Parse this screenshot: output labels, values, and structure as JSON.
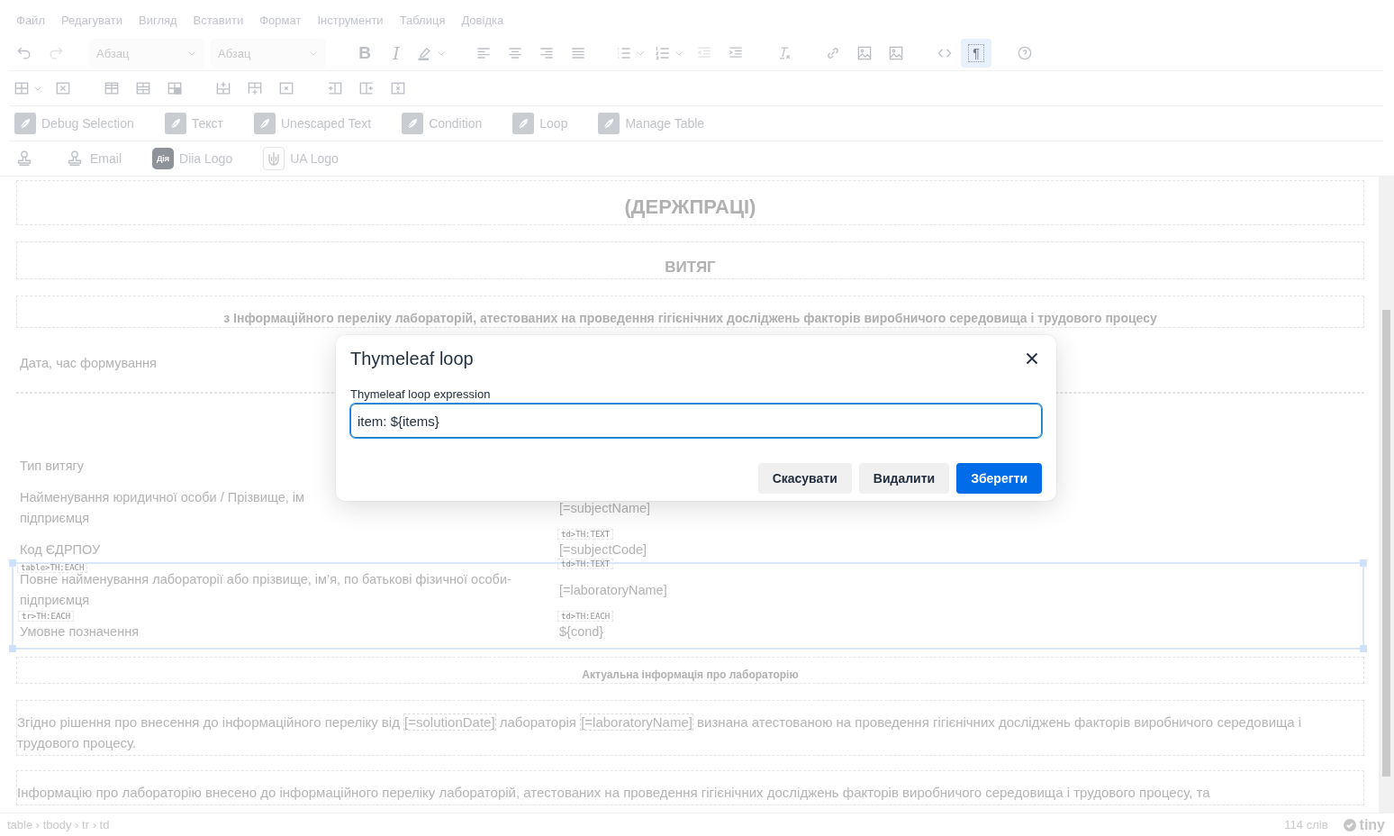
{
  "menubar": [
    "Файл",
    "Редагувати",
    "Вигляд",
    "Вставити",
    "Формат",
    "Інструменти",
    "Таблиця",
    "Довідка"
  ],
  "toolbar": {
    "rows": [
      [
        [
          {
            "kind": "button",
            "disabled": false,
            "active": false
          },
          {
            "kind": "button",
            "disabled": true,
            "active": false
          }
        ],
        [
          {
            "kind": "select",
            "value": "Абзац",
            "disabled": false,
            "active": false
          },
          {
            "kind": "select",
            "value": "Абзац",
            "disabled": false,
            "active": false
          }
        ],
        [
          {
            "kind": "glyph",
            "glyph": "B",
            "disabled": false,
            "active": false
          },
          {
            "kind": "glyph",
            "glyph": "I",
            "disabled": false,
            "active": false
          },
          {
            "kind": "split",
            "disabled": false,
            "active": false
          }
        ],
        [
          {
            "kind": "button",
            "disabled": false,
            "active": false
          },
          {
            "kind": "button",
            "disabled": false,
            "active": false
          },
          {
            "kind": "button",
            "disabled": false,
            "active": false
          },
          {
            "kind": "button",
            "disabled": false,
            "active": false
          }
        ],
        [
          {
            "kind": "split",
            "disabled": false,
            "active": false
          },
          {
            "kind": "split",
            "disabled": false,
            "active": false
          },
          {
            "kind": "button",
            "disabled": true,
            "active": false
          },
          {
            "kind": "button",
            "disabled": false,
            "active": false
          }
        ],
        [
          {
            "kind": "button",
            "disabled": false,
            "active": false
          }
        ],
        [
          {
            "kind": "button",
            "disabled": false,
            "active": false
          },
          {
            "kind": "button",
            "disabled": false,
            "active": false
          },
          {
            "kind": "button",
            "disabled": false,
            "active": false
          }
        ],
        [
          {
            "kind": "button",
            "disabled": false,
            "active": false
          },
          {
            "kind": "glyph-box",
            "glyph": "¶",
            "disabled": false,
            "active": true
          }
        ],
        [
          {
            "kind": "button",
            "disabled": false,
            "active": false
          }
        ]
      ],
      [
        [
          {
            "kind": "split",
            "disabled": false,
            "active": false
          },
          {
            "kind": "button",
            "disabled": false,
            "active": false
          }
        ],
        [
          {
            "kind": "button",
            "disabled": false,
            "active": false
          },
          {
            "kind": "button",
            "disabled": false,
            "active": false
          },
          {
            "kind": "button",
            "disabled": false,
            "active": false
          }
        ],
        [
          {
            "kind": "button",
            "disabled": false,
            "active": false
          },
          {
            "kind": "button",
            "disabled": false,
            "active": false
          },
          {
            "kind": "button",
            "disabled": false,
            "active": false
          }
        ],
        [
          {
            "kind": "button",
            "disabled": false,
            "active": false
          },
          {
            "kind": "button",
            "disabled": false,
            "active": false
          },
          {
            "kind": "button",
            "disabled": false,
            "active": false
          }
        ]
      ]
    ]
  },
  "custom_rows": [
    [
      {
        "kind": "feather",
        "label": "Debug Selection"
      },
      {
        "kind": "feather",
        "label": "Текст"
      },
      {
        "kind": "feather",
        "label": "Unescaped Text"
      },
      {
        "kind": "feather",
        "label": "Condition"
      },
      {
        "kind": "feather",
        "label": "Loop"
      },
      {
        "kind": "feather",
        "label": "Manage Table"
      }
    ],
    [
      {
        "kind": "stamp"
      },
      {
        "kind": "stamp",
        "label": "Email"
      },
      {
        "kind": "badge",
        "badge": "Дія",
        "label": "Diia Logo"
      },
      {
        "kind": "trident",
        "label": "UA Logo"
      }
    ]
  ],
  "document": [
    {
      "kind": "heading",
      "text": "(ДЕРЖПРАЦІ)"
    },
    {
      "kind": "heading",
      "text": "ВИТЯГ"
    },
    {
      "kind": "heading",
      "text": "з Інформаційного переліку лабораторій, атестованих на проведення гігієнічних досліджень факторів виробничого середовища і трудового процесу"
    },
    {
      "kind": "table",
      "selected": false,
      "rows": [
        {
          "label": "Дата, час формування"
        }
      ]
    },
    {
      "kind": "empty"
    },
    {
      "kind": "table",
      "selected": false,
      "rows": [
        {
          "label": "Тип витягу"
        },
        {
          "label": "Найменування юридичної особи / Прізвище, ім",
          "label_2": "підприємця",
          "value": "[=subjectName]"
        },
        {
          "label": "Код ЄДРПОУ",
          "value": "[=subjectCode]",
          "value_tag": "td>TH:TEXT"
        }
      ]
    },
    {
      "kind": "table",
      "selected": true,
      "tag": "table>TH:EACH",
      "rows": [
        {
          "label": "Повне найменування лабораторії або прізвище, ім’я, по батькові фізичної особи-підприємця",
          "value": "[=laboratoryName]",
          "value_tag": "td>TH:TEXT"
        },
        {
          "label": "Умовне позначення",
          "label_tag": "tr>TH:EACH",
          "value": "${cond}",
          "value_tag": "td>TH:EACH"
        }
      ]
    },
    {
      "kind": "heading",
      "text": "Актуальна інформація про лабораторію"
    },
    {
      "kind": "paragraph",
      "parts": [
        {
          "kind": "text",
          "text": "Згідно рішення про внесення до інформаційного переліку від "
        },
        {
          "kind": "var",
          "text": "[=solutionDate]"
        },
        {
          "kind": "text",
          "text": " лабораторія "
        },
        {
          "kind": "var",
          "text": "[=laboratoryName]"
        },
        {
          "kind": "text",
          "text": " визнана атестованою на проведення гігієнічних досліджень факторів виробничого середовища і трудового процесу."
        }
      ]
    },
    {
      "kind": "paragraph",
      "parts": [
        {
          "kind": "text",
          "text": "Інформацію про лабораторію внесено до інформаційного переліку лабораторій, атестованих на проведення гігієнічних досліджень факторів виробничого середовища і трудового процесу, та"
        }
      ]
    }
  ],
  "status_bar": {
    "path": "table › tbody › tr › td",
    "word_count": "114 слів",
    "brand": "tiny"
  },
  "dialog": {
    "title": "Thymeleaf loop",
    "field_label": "Thymeleaf loop expression",
    "field_value": "item: ${items}",
    "buttons": [
      {
        "label": "Скасувати",
        "kind": "secondary"
      },
      {
        "label": "Видалити",
        "kind": "secondary"
      },
      {
        "label": "Зберегти",
        "kind": "primary"
      }
    ]
  }
}
